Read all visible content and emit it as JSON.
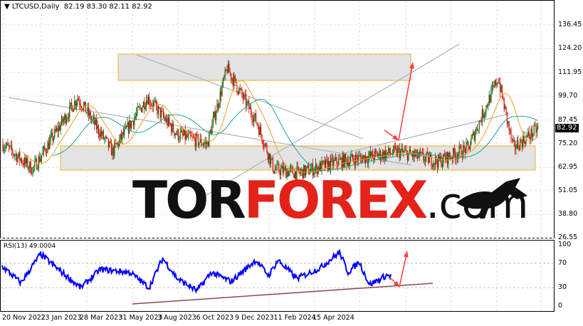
{
  "header": {
    "symbol_title": "LTCUSD,Daily",
    "ohlc": "82.19 83.30 82.11 82.92"
  },
  "price_axis": {
    "ticks": [
      "136.45",
      "124.20",
      "111.95",
      "99.70",
      "87.45",
      "75.20",
      "62.95",
      "51.05",
      "38.80",
      "26.55"
    ],
    "current_price": "82.92"
  },
  "rsi": {
    "title": "RSI(13) 49.0004",
    "ticks": [
      "100",
      "70",
      "30",
      "0"
    ]
  },
  "time_axis": {
    "labels": [
      "20 Nov 2022",
      "23 Jan 2023",
      "28 Mar 2023",
      "31 May 2023",
      "3 Aug 2023",
      "6 Oct 2023",
      "9 Dec 2023",
      "11 Feb 2024",
      "15 Apr 2024"
    ]
  },
  "logo": {
    "part1": "TOR",
    "part2": "FOREX",
    "part3": ".com"
  },
  "colors": {
    "bull": "#006400",
    "bear": "#e00000",
    "rsi": "#0000ff",
    "arrow": "#ff3b3b",
    "zone_border": "#f0b030"
  },
  "chart_data": {
    "type": "candlestick",
    "price_waypoints": [
      [
        0,
        75
      ],
      [
        30,
        62
      ],
      [
        75,
        99
      ],
      [
        110,
        71
      ],
      [
        145,
        99
      ],
      [
        175,
        80
      ],
      [
        205,
        75
      ],
      [
        225,
        114
      ],
      [
        255,
        86
      ],
      [
        272,
        62
      ],
      [
        297,
        60
      ],
      [
        337,
        66
      ],
      [
        397,
        71
      ],
      [
        437,
        66
      ],
      [
        467,
        73
      ],
      [
        497,
        109
      ],
      [
        512,
        73
      ],
      [
        537,
        83
      ]
    ],
    "rsi_waypoints": [
      [
        0,
        65
      ],
      [
        22,
        38
      ],
      [
        45,
        85
      ],
      [
        70,
        55
      ],
      [
        92,
        30
      ],
      [
        115,
        60
      ],
      [
        150,
        55
      ],
      [
        172,
        30
      ],
      [
        188,
        78
      ],
      [
        205,
        45
      ],
      [
        228,
        25
      ],
      [
        245,
        55
      ],
      [
        268,
        40
      ],
      [
        297,
        75
      ],
      [
        312,
        50
      ],
      [
        323,
        75
      ],
      [
        345,
        45
      ],
      [
        372,
        62
      ],
      [
        395,
        88
      ],
      [
        405,
        55
      ],
      [
        418,
        72
      ],
      [
        430,
        35
      ],
      [
        450,
        50
      ],
      [
        455,
        49
      ]
    ]
  }
}
